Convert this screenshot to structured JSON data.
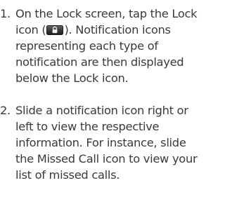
{
  "steps": [
    {
      "number": "1.",
      "lines": [
        "On the Lock screen, tap the Lock",
        "icon (",
        "). Notification icons",
        "representing each type of",
        "notification are then displayed",
        "below the Lock icon."
      ],
      "icon": "lock-icon"
    },
    {
      "number": "2.",
      "lines": [
        "Slide a notification icon right or",
        "left to view the respective",
        "information. For instance, slide",
        "the Missed Call icon to view your",
        "list of missed calls."
      ]
    }
  ],
  "colors": {
    "text": "#3a3a3a",
    "icon_dark": "#2a2a2a",
    "icon_light": "#f2f2f2"
  }
}
